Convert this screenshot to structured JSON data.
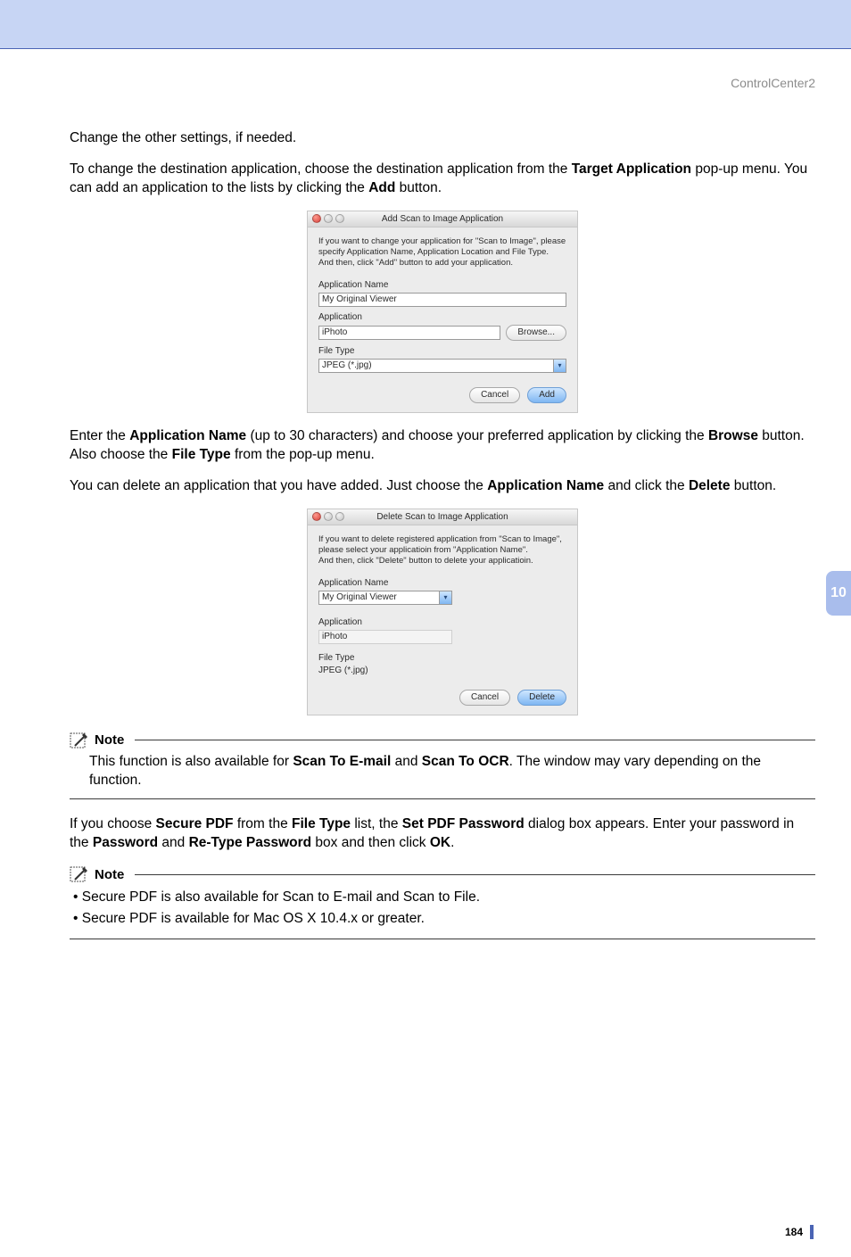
{
  "header": {
    "section": "ControlCenter2"
  },
  "side_tab": "10",
  "page_number": "184",
  "paras": {
    "p1": "Change the other settings, if needed.",
    "p2a": "To change the destination application, choose the destination application from the ",
    "p2b": "Target Application",
    "p2c": " pop-up menu. You can add an application to the lists by clicking the ",
    "p2d": "Add",
    "p2e": " button.",
    "p3a": "Enter the ",
    "p3b": "Application Name",
    "p3c": " (up to 30 characters) and choose your preferred application by clicking the ",
    "p3d": "Browse",
    "p3e": " button. Also choose the ",
    "p3f": "File Type",
    "p3g": " from the pop-up menu.",
    "p4a": "You can delete an application that you have added. Just choose the ",
    "p4b": "Application Name",
    "p4c": " and click the ",
    "p4d": "Delete",
    "p4e": " button.",
    "p5a": "If you choose ",
    "p5b": "Secure PDF",
    "p5c": " from the ",
    "p5d": "File Type",
    "p5e": " list, the ",
    "p5f": "Set PDF Password",
    "p5g": " dialog box appears. Enter your password in the ",
    "p5h": "Password",
    "p5i": " and ",
    "p5j": "Re-Type Password",
    "p5k": " box and then click ",
    "p5l": "OK",
    "p5m": "."
  },
  "note1": {
    "title": "Note",
    "t1": "This function is also available for ",
    "b1": "Scan To E-mail",
    "t2": " and ",
    "b2": "Scan To OCR",
    "t3": ". The window may vary depending on the function."
  },
  "note2": {
    "title": "Note",
    "li1": "Secure PDF is also available for Scan to E-mail and Scan to File.",
    "li2": "Secure PDF is available for Mac OS X 10.4.x or greater."
  },
  "dialog_add": {
    "title": "Add Scan to Image Application",
    "instr": "If you want to change your application for \"Scan to Image\", please specify Application Name, Application Location and File Type.\nAnd then, click \"Add\" button to add your application.",
    "labels": {
      "app_name": "Application Name",
      "application": "Application",
      "file_type": "File Type"
    },
    "values": {
      "app_name": "My Original Viewer",
      "application": "iPhoto",
      "file_type": "JPEG (*.jpg)"
    },
    "buttons": {
      "browse": "Browse...",
      "cancel": "Cancel",
      "add": "Add"
    }
  },
  "dialog_delete": {
    "title": "Delete Scan to Image Application",
    "instr": "If you want to delete registered application from \"Scan to Image\", please select your applicatioin from \"Application Name\".\nAnd then, click \"Delete\" button to delete your applicatioin.",
    "labels": {
      "app_name": "Application Name",
      "application": "Application",
      "file_type": "File Type"
    },
    "values": {
      "app_name": "My Original Viewer",
      "application": "iPhoto",
      "file_type": "JPEG (*.jpg)"
    },
    "buttons": {
      "cancel": "Cancel",
      "delete": "Delete"
    }
  }
}
